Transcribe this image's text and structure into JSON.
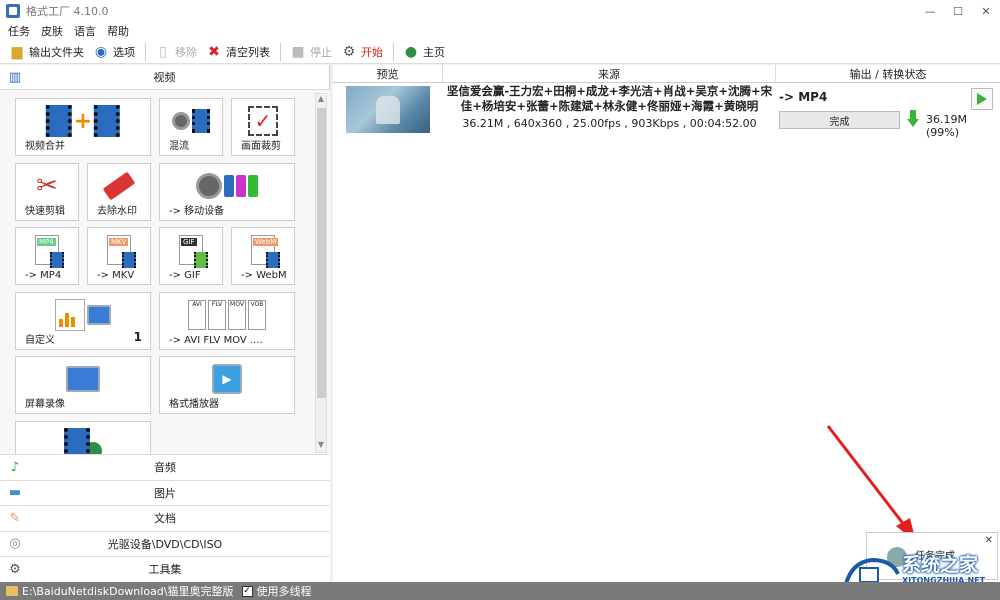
{
  "window": {
    "title": "格式工厂 4.10.0",
    "minimize": "—",
    "maximize": "☐",
    "close": "✕"
  },
  "menu": [
    "任务",
    "皮肤",
    "语言",
    "帮助"
  ],
  "toolbar": {
    "output_folder": "输出文件夹",
    "options": "选项",
    "remove": "移除",
    "clear_list": "清空列表",
    "stop": "停止",
    "start": "开始",
    "home": "主页"
  },
  "left": {
    "video_header": "视频",
    "tiles": {
      "merge": "视频合并",
      "mux": "混流",
      "crop": "画面裁剪",
      "quick_clip": "快速剪辑",
      "remove_watermark": "去除水印",
      "mobile": "-> 移动设备",
      "mp4": "-> MP4",
      "mkv": "-> MKV",
      "gif": "-> GIF",
      "webm": "-> WebM",
      "custom": "自定义",
      "custom_count": "1",
      "avi": "-> AVI FLV MOV ....",
      "screen_record": "屏幕录像",
      "player": "格式播放器"
    },
    "icon_labels": {
      "mp4": "MP4",
      "mkv": "MKV",
      "gif": "GIF",
      "webm": "WebM",
      "avi": "AVI",
      "flv": "FLV",
      "mov": "MOV",
      "vob": "VOB"
    },
    "categories": [
      "音频",
      "图片",
      "文档",
      "光驱设备\\DVD\\CD\\ISO",
      "工具集"
    ]
  },
  "table": {
    "headers": {
      "preview": "预览",
      "source": "来源",
      "output": "输出 / 转换状态"
    },
    "rows": [
      {
        "title": "坚信爱会赢-王力宏+田桐+成龙+李光洁+肖战+吴京+沈腾+宋佳+杨培安+张蕾+陈建斌+林永健+佟丽娅+海霞+黄晓明",
        "meta": "36.21M , 640x360 , 25.00fps , 903Kbps , 00:04:52.00",
        "format": "-> MP4",
        "status": "完成",
        "output_size": "36.19M",
        "output_percent": "(99%)"
      }
    ]
  },
  "toast": {
    "text": "任务完成",
    "close": "✕"
  },
  "watermark": {
    "text": "系统之家",
    "url": "XITONGZHIJIA.NET"
  },
  "statusbar": {
    "path": "E:\\BaiduNetdiskDownload\\猫里奥完整版",
    "multithread": "使用多线程",
    "check": "✓"
  },
  "colors": {
    "accent_start": "#dd2222",
    "play_green": "#3cb33c",
    "film_blue": "#2b6cbf",
    "annotation_red": "#e02020"
  }
}
